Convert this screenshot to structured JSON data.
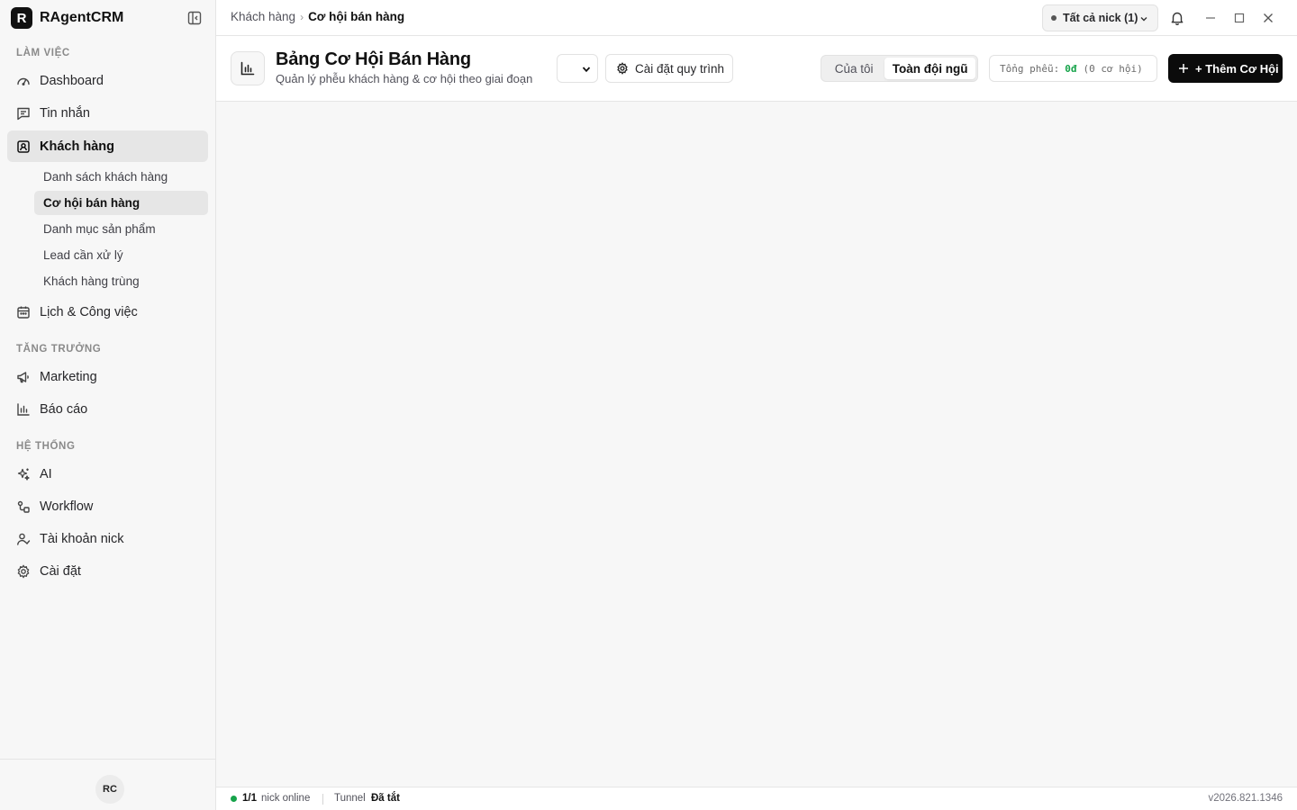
{
  "app": {
    "logo_letter": "R",
    "name": "RAgentCRM"
  },
  "sidebar": {
    "sections": {
      "work": "LÀM VIỆC",
      "growth": "TĂNG TRƯỞNG",
      "system": "HỆ THỐNG"
    },
    "items": {
      "dashboard": "Dashboard",
      "messages": "Tin nhắn",
      "customers": "Khách hàng",
      "calendar": "Lịch & Công việc",
      "marketing": "Marketing",
      "reports": "Báo cáo",
      "ai": "AI",
      "workflow": "Workflow",
      "nick_accounts": "Tài khoản nick",
      "settings": "Cài đặt"
    },
    "customer_sub": {
      "list": "Danh sách khách hàng",
      "opportunities": "Cơ hội bán hàng",
      "products": "Danh mục sản phẩm",
      "leads": "Lead cần xử lý",
      "duplicates": "Khách hàng trùng"
    },
    "avatar_initials": "RC"
  },
  "topbar": {
    "breadcrumb_parent": "Khách hàng",
    "breadcrumb_separator": "›",
    "breadcrumb_current": "Cơ hội bán hàng",
    "nick_filter": "Tất cả nick (1)"
  },
  "header": {
    "title": "Bảng Cơ Hội Bán Hàng",
    "subtitle": "Quản lý phễu khách hàng & cơ hội theo giai đoạn",
    "pipeline_value": "",
    "settings_label": "Cài đặt quy trình",
    "scope_mine": "Của tôi",
    "scope_team": "Toàn đội ngũ",
    "scope_selected": "team",
    "funnel_label": "Tổng phễu:",
    "funnel_amount": "0đ",
    "funnel_count": "(0 cơ hội)",
    "add_label": "+ Thêm Cơ Hội"
  },
  "status": {
    "online_count": "1/1",
    "online_label": "nick online",
    "tunnel_label": "Tunnel",
    "tunnel_value": "Đã tắt",
    "version": "v2026.821.1346"
  },
  "colors": {
    "accent": "#0b0b0b",
    "online": "#16a34a",
    "sidebar_bg": "#f7f7f7",
    "active_bg": "#e6e6e6"
  },
  "icons": {
    "dashboard": "gauge-icon",
    "messages": "message-square-icon",
    "customers": "contact-icon",
    "calendar": "calendar-icon",
    "marketing": "megaphone-icon",
    "reports": "bar-chart-icon",
    "ai": "sparkles-icon",
    "workflow": "workflow-icon",
    "nick_accounts": "user-check-icon",
    "settings": "gear-icon"
  }
}
